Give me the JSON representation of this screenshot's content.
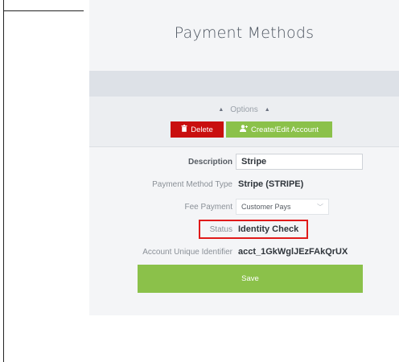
{
  "page": {
    "title": "Payment Methods"
  },
  "options": {
    "label": "Options"
  },
  "actions": {
    "delete_label": "Delete",
    "create_edit_label": "Create/Edit Account"
  },
  "form": {
    "description": {
      "label": "Description",
      "value": "Stripe"
    },
    "method_type": {
      "label": "Payment Method Type",
      "value": "Stripe (STRIPE)"
    },
    "fee_payment": {
      "label": "Fee Payment",
      "value": "Customer Pays"
    },
    "status": {
      "label": "Status",
      "value": "Identity Check"
    },
    "account_id": {
      "label": "Account Unique Identifier",
      "value": "acct_1GkWglJEzFAkQrUX"
    }
  },
  "save_label": "Save",
  "icons": {
    "delete": "trash-icon",
    "create": "user-add-icon",
    "options_toggle": "triangle-up-icon",
    "select": "chevron-down-icon"
  },
  "colors": {
    "danger": "#c90f0f",
    "success": "#8bc14a",
    "highlight": "#e01a1a"
  }
}
